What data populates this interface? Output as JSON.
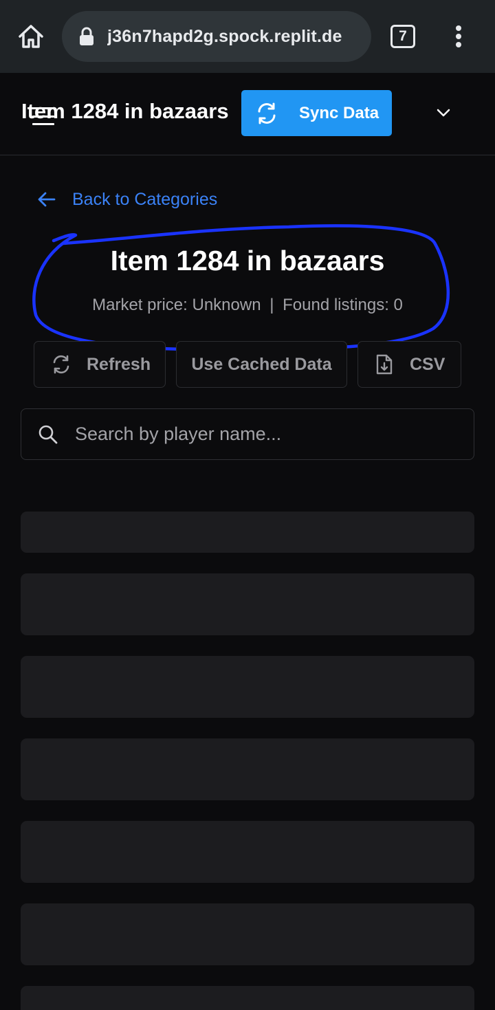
{
  "browser": {
    "url": "j36n7hapd2g.spock.replit.de",
    "tab_count": "7"
  },
  "header": {
    "title": "Item 1284 in bazaars",
    "sync_label": "Sync Data"
  },
  "back_link": "Back to Categories",
  "item": {
    "title": "Item 1284 in bazaars",
    "market_price": "Market price: Unknown",
    "separator": "|",
    "found_listings": "Found listings: 0"
  },
  "actions": {
    "refresh": "Refresh",
    "cached": "Use Cached Data",
    "csv": "CSV"
  },
  "search": {
    "placeholder": "Search by player name..."
  },
  "colors": {
    "accent": "#2196f3",
    "link": "#3b82f6",
    "annotation": "#1a33ff",
    "background": "#0b0b0d"
  }
}
